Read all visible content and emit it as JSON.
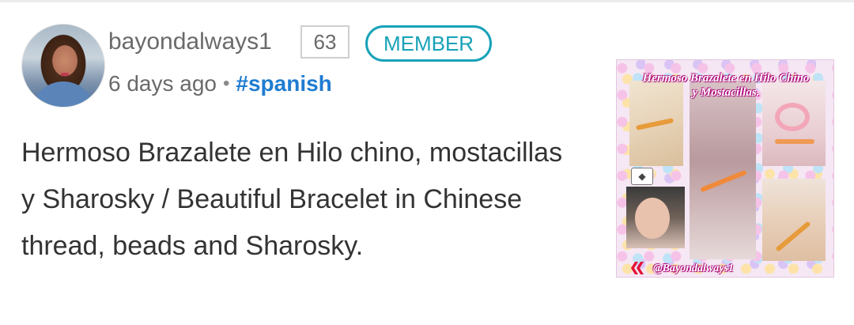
{
  "post": {
    "author": "bayondalways1",
    "reputation": "63",
    "badge": "MEMBER",
    "age": "6 days ago",
    "separator": "•",
    "tag": "#spanish",
    "title": "Hermoso Brazalete en Hilo chino, mostacillas y Sharosky / Beautiful Bracelet in Chinese thread, beads and Sharosky.",
    "thumbnail": {
      "title": "Hermoso Brazalete en Hilo Chino y Mostacillas.",
      "handle": "@Bayondalways1"
    }
  },
  "icons": {
    "avatar": "user-avatar-photo",
    "hive": "hive-logo-icon",
    "diamond": "diamond-icon"
  },
  "colors": {
    "accent": "#17a2b8",
    "tag": "#1f7cd1",
    "text": "#333333",
    "muted": "#6a6a6a"
  }
}
